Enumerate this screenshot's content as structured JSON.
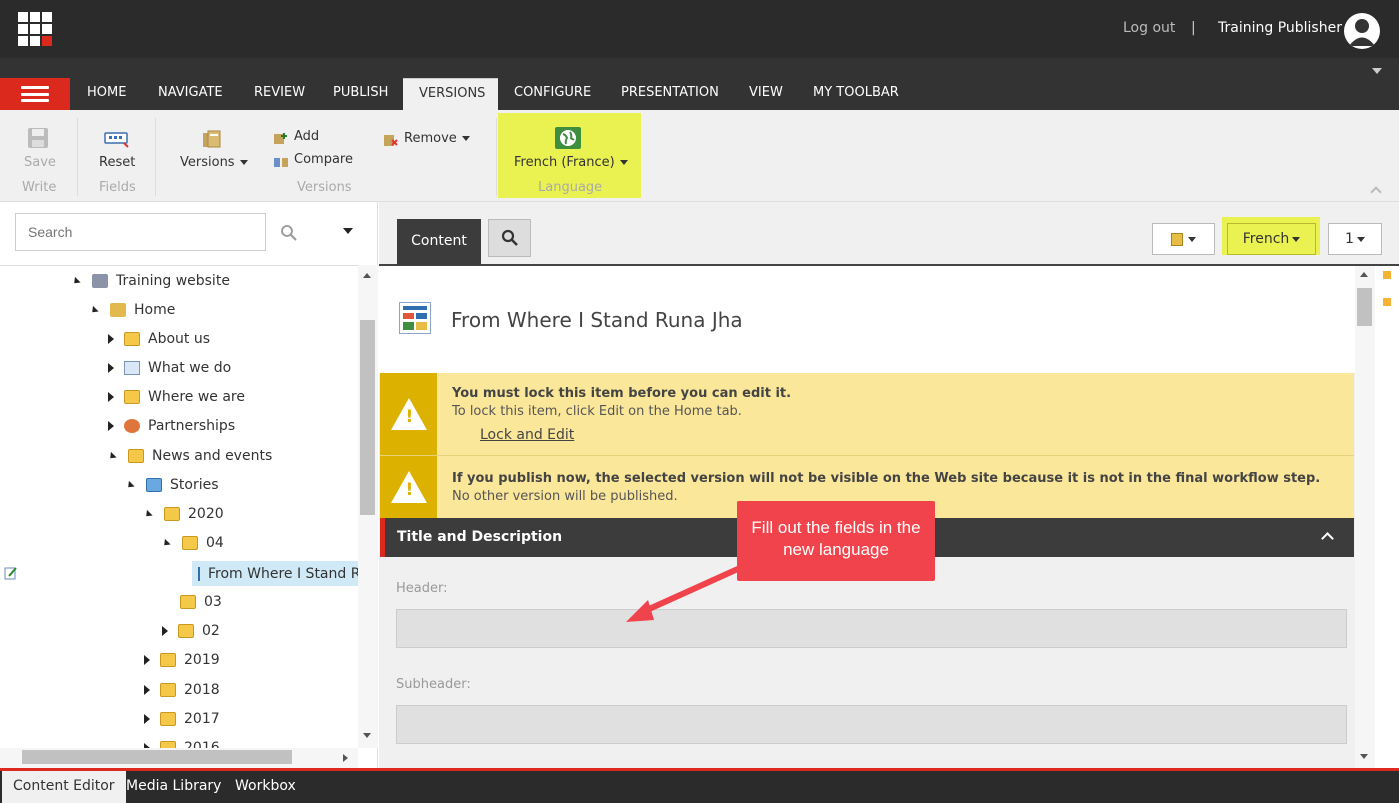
{
  "topbar": {
    "logout": "Log out",
    "separator": "|",
    "user": "Training Publisher"
  },
  "ribbon_tabs": [
    "HOME",
    "NAVIGATE",
    "REVIEW",
    "PUBLISH",
    "VERSIONS",
    "CONFIGURE",
    "PRESENTATION",
    "VIEW",
    "MY TOOLBAR"
  ],
  "ribbon": {
    "write": {
      "save": "Save",
      "group": "Write"
    },
    "fields": {
      "reset": "Reset",
      "group": "Fields"
    },
    "versions": {
      "versions": "Versions",
      "add": "Add",
      "compare": "Compare",
      "remove": "Remove",
      "group": "Versions"
    },
    "language": {
      "value": "French (France)",
      "group": "Language"
    }
  },
  "search": {
    "placeholder": "Search"
  },
  "tree": [
    {
      "label": "Training website"
    },
    {
      "label": "Home"
    },
    {
      "label": "About us"
    },
    {
      "label": "What we do"
    },
    {
      "label": "Where we are"
    },
    {
      "label": "Partnerships"
    },
    {
      "label": "News and events"
    },
    {
      "label": "Stories"
    },
    {
      "label": "2020"
    },
    {
      "label": "04"
    },
    {
      "label": "From Where I Stand R"
    },
    {
      "label": "03"
    },
    {
      "label": "02"
    },
    {
      "label": "2019"
    },
    {
      "label": "2018"
    },
    {
      "label": "2017"
    },
    {
      "label": "2016"
    }
  ],
  "content_header": {
    "tab_content": "Content",
    "language_button": "French",
    "version_button": "1"
  },
  "item": {
    "title": "From Where I Stand Runa Jha"
  },
  "warnings": [
    {
      "title": "You must lock this item before you can edit it.",
      "text": "To lock this item, click Edit on the Home tab.",
      "link": "Lock and Edit"
    },
    {
      "title": "If you publish now, the selected version will not be visible on the Web site because it is not in the final workflow step.",
      "text": "No other version will be published."
    }
  ],
  "section": {
    "title": "Title and Description"
  },
  "fields": {
    "header_label": "Header:",
    "subheader_label": "Subheader:"
  },
  "callout": {
    "line1": "Fill out the fields in the",
    "line2": "new language"
  },
  "bottom_tabs": [
    "Content Editor",
    "Media Library",
    "Workbox"
  ],
  "colors": {
    "brand_red": "#dc291e",
    "highlight": "#eaf252",
    "warning_bg": "#fbe79a",
    "warning_icon": "#dcb100",
    "callout": "#f0434b"
  }
}
